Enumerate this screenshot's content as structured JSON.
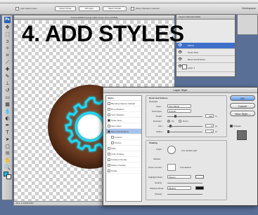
{
  "overlay_title": "4. ADD STYLES",
  "options_bar": {
    "auto_select": "Auto Select Layer",
    "show_bounds": "Show Transform Controls",
    "buttons": [
      "Select Pixels",
      "Fill Layer",
      "Select Similar"
    ],
    "workspace": "Workspace"
  },
  "document": {
    "title": "Pretzel-DNPET.psd @ 100% (Outer Glow, RGB/8)",
    "status": "Doc: 1.43M/5.25M"
  },
  "layers_panel": {
    "tabs": "Layers  Channels  Paths",
    "rows": [
      "Effects",
      "Outer Glow",
      "Bevel and Emboss",
      "Layer 1"
    ]
  },
  "dialog": {
    "title": "Layer Style",
    "styles_header": "Styles",
    "style_items": [
      {
        "label": "Blending Options: Default",
        "checked": false,
        "active": false,
        "sub": false
      },
      {
        "label": "Drop Shadow",
        "checked": false,
        "active": false,
        "sub": false
      },
      {
        "label": "Inner Shadow",
        "checked": false,
        "active": false,
        "sub": false
      },
      {
        "label": "Outer Glow",
        "checked": true,
        "active": false,
        "sub": false
      },
      {
        "label": "Inner Glow",
        "checked": false,
        "active": false,
        "sub": false
      },
      {
        "label": "Bevel and Emboss",
        "checked": true,
        "active": true,
        "sub": false
      },
      {
        "label": "Contour",
        "checked": false,
        "active": false,
        "sub": true
      },
      {
        "label": "Texture",
        "checked": false,
        "active": false,
        "sub": true
      },
      {
        "label": "Satin",
        "checked": false,
        "active": false,
        "sub": false
      },
      {
        "label": "Color Overlay",
        "checked": false,
        "active": false,
        "sub": false
      },
      {
        "label": "Gradient Overlay",
        "checked": false,
        "active": false,
        "sub": false
      },
      {
        "label": "Pattern Overlay",
        "checked": false,
        "active": false,
        "sub": false
      },
      {
        "label": "Stroke",
        "checked": false,
        "active": false,
        "sub": false
      }
    ],
    "structure": {
      "title": "Bevel and Emboss",
      "subtitle": "Structure",
      "style_label": "Style:",
      "style_value": "Inner Bevel",
      "technique_label": "Technique:",
      "technique_value": "Smooth",
      "depth_label": "Depth:",
      "depth_value": "100",
      "direction_label": "Direction:",
      "direction_up": "Up",
      "direction_down": "Down",
      "size_label": "Size:",
      "size_value": "5",
      "soften_label": "Soften:",
      "soften_value": "0",
      "percent": "%",
      "px": "px"
    },
    "shading": {
      "title": "Shading",
      "angle_label": "Angle:",
      "global_light": "Use Global Light",
      "altitude_label": "Altitude:",
      "gloss_label": "Gloss Contour:",
      "anti_aliased": "Anti-aliased",
      "highlight_label": "Highlight Mode:",
      "highlight_value": "Screen",
      "highlight_opacity_label": "Opacity:",
      "shadow_label": "Shadow Mode:",
      "shadow_value": "Multiply",
      "shadow_opacity_label": "Opacity:"
    },
    "buttons": {
      "ok": "OK",
      "cancel": "Cancel",
      "new_style": "New Style...",
      "preview": "Preview"
    }
  },
  "colors": {
    "glow": "#1fd8f5",
    "donut": "#6b3a1f",
    "foreground": "#15bde6"
  }
}
